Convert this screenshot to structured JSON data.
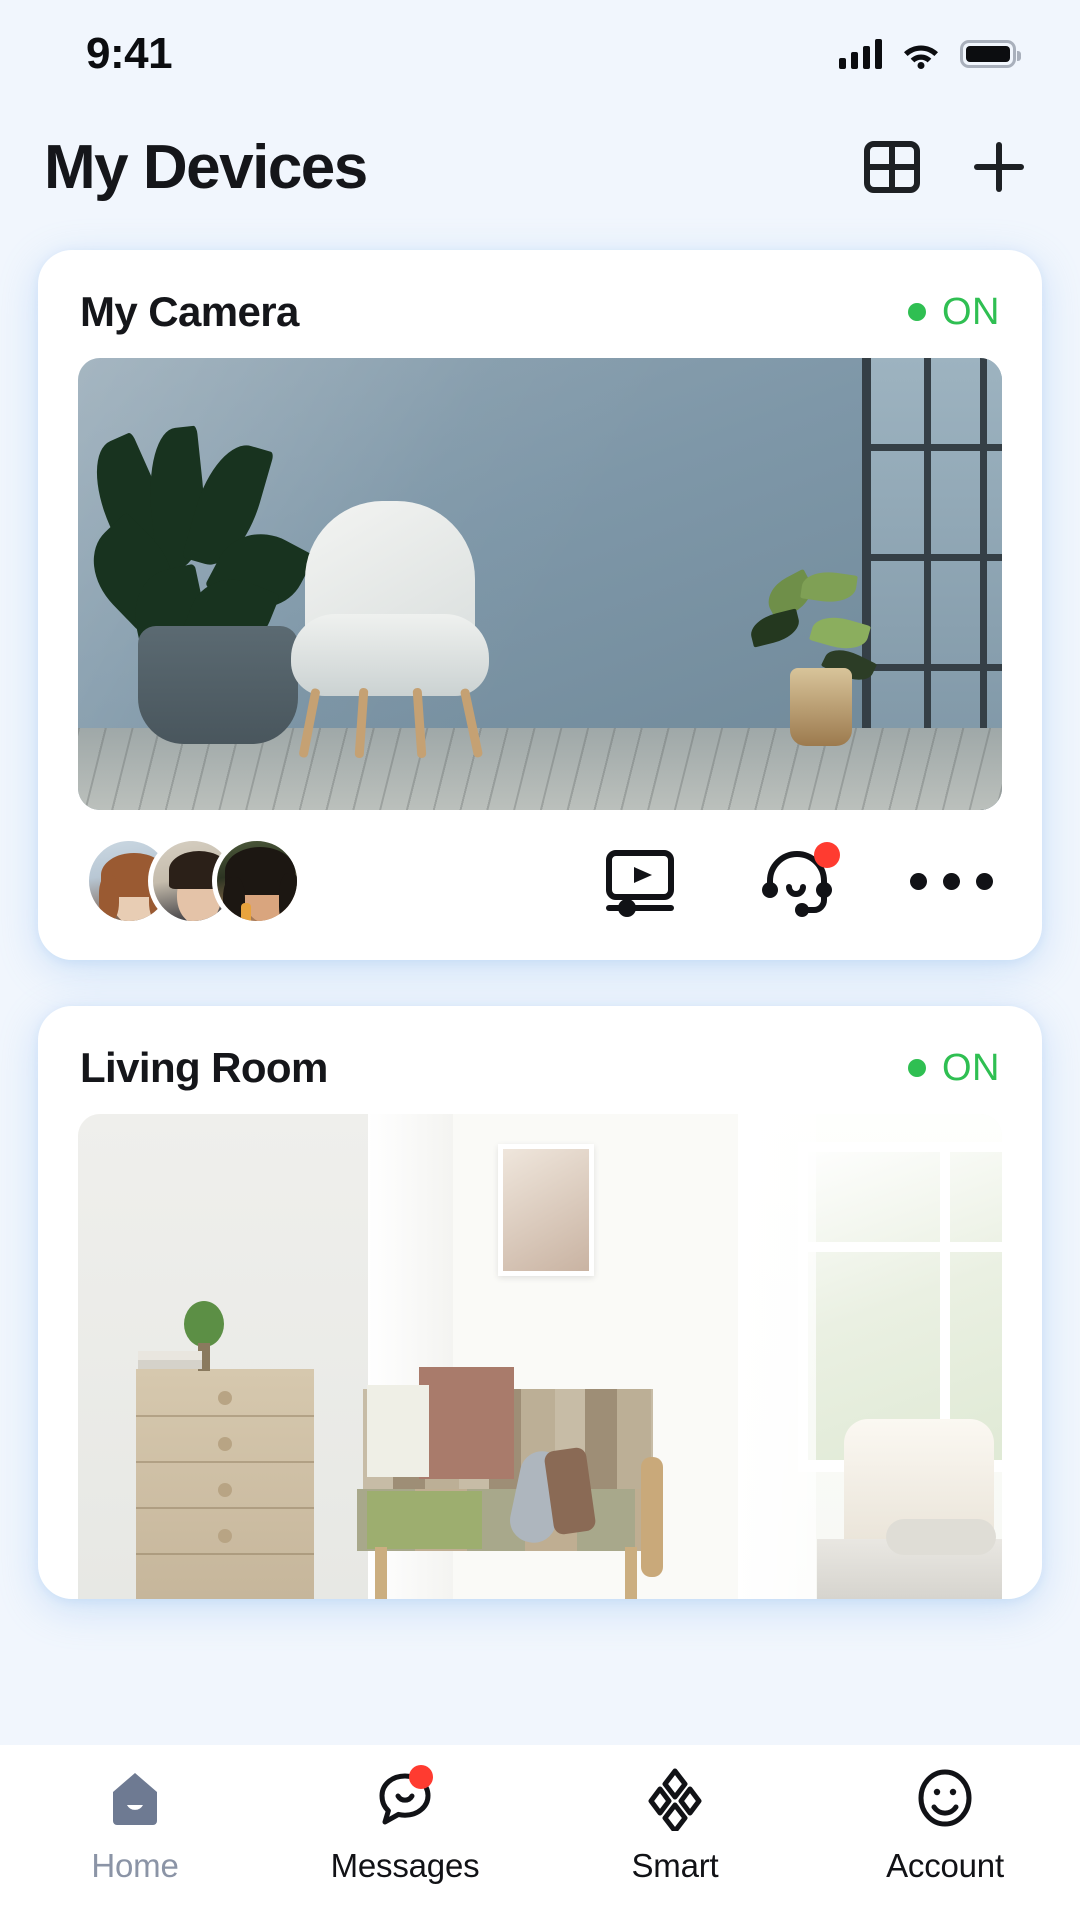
{
  "status_bar": {
    "time": "9:41",
    "signal_icon": "cellular-signal-icon",
    "wifi_icon": "wifi-icon",
    "battery_icon": "battery-full-icon"
  },
  "header": {
    "title": "My Devices",
    "grid_view_icon": "grid-view-icon",
    "add_icon": "plus-icon"
  },
  "colors": {
    "background": "#F1F6FD",
    "card": "#FFFFFF",
    "status_on": "#2FBF52",
    "badge_red": "#FF3B30",
    "text_primary": "#15161A",
    "tab_inactive": "#8B94A6",
    "home_icon": "#6E7A92"
  },
  "devices": [
    {
      "name": "My Camera",
      "status_label": "ON",
      "status_dot": "online-dot",
      "preview": "camera-preview-living-space",
      "viewers": [
        {
          "name": "viewer-avatar-1"
        },
        {
          "name": "viewer-avatar-2"
        },
        {
          "name": "viewer-avatar-3"
        }
      ],
      "actions": [
        {
          "name": "playback-icon",
          "badge": false
        },
        {
          "name": "support-headset-icon",
          "badge": true
        },
        {
          "name": "more-options-icon",
          "badge": false
        }
      ]
    },
    {
      "name": "Living Room",
      "status_label": "ON",
      "status_dot": "online-dot",
      "preview": "camera-preview-bedroom"
    }
  ],
  "tabbar": {
    "items": [
      {
        "label": "Home",
        "icon": "home-icon",
        "active": true,
        "badge": false
      },
      {
        "label": "Messages",
        "icon": "messages-icon",
        "active": false,
        "badge": true
      },
      {
        "label": "Smart",
        "icon": "smart-icon",
        "active": false,
        "badge": false
      },
      {
        "label": "Account",
        "icon": "account-icon",
        "active": false,
        "badge": false
      }
    ]
  }
}
